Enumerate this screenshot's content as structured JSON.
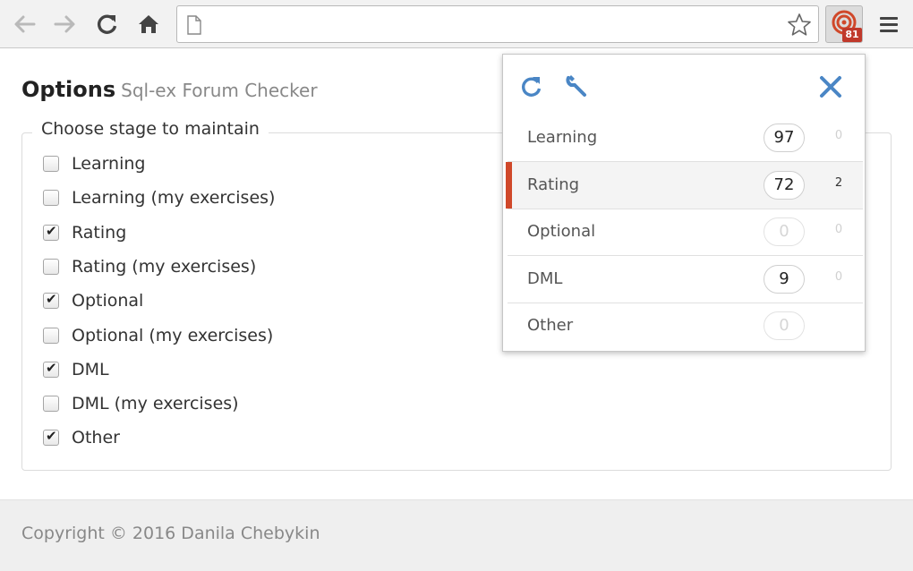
{
  "browser": {
    "address_value": "",
    "extension_badge": "81",
    "icons": [
      "back-arrow-icon",
      "forward-arrow-icon",
      "reload-icon",
      "home-icon",
      "page-icon",
      "star-icon",
      "target-icon",
      "menu-icon"
    ]
  },
  "options": {
    "title": "Options",
    "subtitle": "Sql-ex Forum Checker",
    "legend": "Choose stage to maintain",
    "items": [
      {
        "label": "Learning",
        "checked": false
      },
      {
        "label": "Learning (my exercises)",
        "checked": false
      },
      {
        "label": "Rating",
        "checked": true
      },
      {
        "label": "Rating (my exercises)",
        "checked": false
      },
      {
        "label": "Optional",
        "checked": true
      },
      {
        "label": "Optional (my exercises)",
        "checked": false
      },
      {
        "label": "DML",
        "checked": true
      },
      {
        "label": "DML (my exercises)",
        "checked": false
      },
      {
        "label": "Other",
        "checked": true
      }
    ]
  },
  "footer": {
    "copyright": "Copyright © 2016 Danila Chebykin"
  },
  "popup": {
    "icons": [
      "refresh-icon",
      "wrench-icon",
      "close-icon"
    ],
    "stages": [
      {
        "name": "Learning",
        "count": "97",
        "mine": "0",
        "active": false
      },
      {
        "name": "Rating",
        "count": "72",
        "mine": "2",
        "active": true
      },
      {
        "name": "Optional",
        "count": "0",
        "mine": "0",
        "active": false
      },
      {
        "name": "DML",
        "count": "9",
        "mine": "0",
        "active": false
      },
      {
        "name": "Other",
        "count": "0",
        "mine": "",
        "active": false
      }
    ]
  },
  "colors": {
    "accent_icon": "#4a86c5",
    "active_marker": "#d0482a",
    "badge": "#c0392b"
  }
}
